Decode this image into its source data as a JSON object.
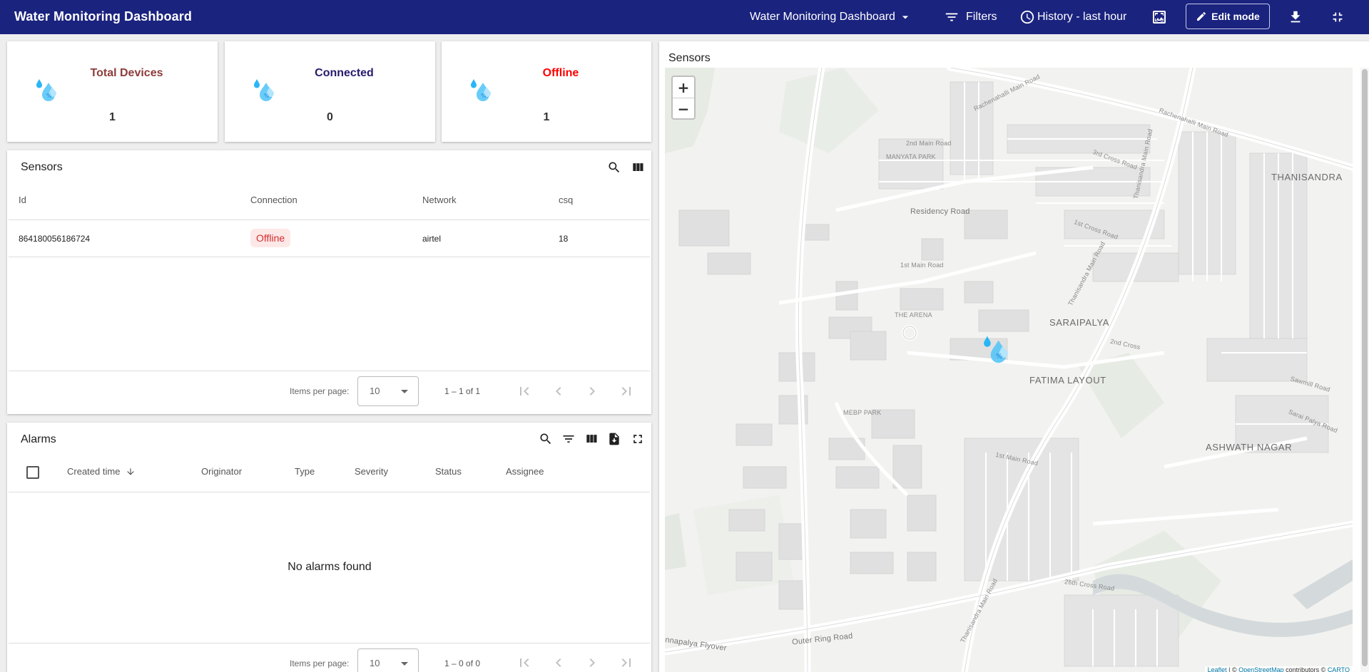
{
  "header": {
    "app_title": "Water Monitoring Dashboard",
    "dashboard_selector": "Water Monitoring Dashboard",
    "filters_label": "Filters",
    "history_label": "History - last hour",
    "edit_mode_label": "Edit mode",
    "icons": [
      "chevron-down-icon",
      "filter-icon",
      "clock-icon",
      "image-icon",
      "pencil-icon",
      "download-icon",
      "exit-fullscreen-icon"
    ]
  },
  "stats": [
    {
      "title": "Total Devices",
      "value": "1",
      "color": "#8d3b3b"
    },
    {
      "title": "Connected",
      "value": "0",
      "color": "#2a1a6e"
    },
    {
      "title": "Offline",
      "value": "1",
      "color": "#ff0000"
    }
  ],
  "sensors_table": {
    "title": "Sensors",
    "columns": [
      "Id",
      "Connection",
      "Network",
      "csq"
    ],
    "rows": [
      {
        "id": "864180056186724",
        "connection": "Offline",
        "network": "airtel",
        "csq": "18"
      }
    ],
    "items_per_page_label": "Items per page:",
    "items_per_page": "10",
    "range": "1 – 1 of 1"
  },
  "alarms_table": {
    "title": "Alarms",
    "columns": [
      "Created time",
      "Originator",
      "Type",
      "Severity",
      "Status",
      "Assignee"
    ],
    "empty_message": "No alarms found",
    "items_per_page_label": "Items per page:",
    "items_per_page": "10",
    "range": "1 – 0 of 0"
  },
  "map": {
    "title": "Sensors",
    "zoom_in": "+",
    "zoom_out": "−",
    "labels": {
      "rachenahalli": "Rachenahalli Main Road",
      "rachenahalli2": "Rachenahalli Main Road",
      "manyata": "MANYATA PARK",
      "second_main": "2nd Main Road",
      "residency": "Residency Road",
      "first_main": "1st Main Road",
      "arena": "THE ARENA",
      "thanisandra": "THANISANDRA",
      "saraipalya": "SARAIPALYA",
      "fatima": "FATIMA LAYOUT",
      "mebp": "MEBP PARK",
      "ashwath": "ASHWATH NAGAR",
      "outer_ring": "Outer Ring Road",
      "flyover": "nnapalya Flyover",
      "thanisandra_main": "Thanisandra Main Road",
      "thanisandra_main2": "Thanisandra Main Road",
      "thanisandra_main3": "Thanisandra Main Road",
      "third_cross": "3rd Cross Road",
      "first_cross": "1st Cross Road",
      "second_cross": "2nd Cross",
      "sawmill": "Sawmill Road",
      "saraipal": "Sarai Palya Road",
      "first_main_b": "1st Main Road",
      "twenty_sixth": "26th Cross Road"
    },
    "attribution_leaflet": "Leaflet",
    "attribution_mid": " | © ",
    "attribution_osm": "OpenStreetMap",
    "attribution_tail": " contributors © ",
    "attribution_carto": "CARTO"
  },
  "colors": {
    "header_bg": "#1a237e",
    "offline_red": "#d32f2f",
    "water_icon": "#4fc3f7"
  }
}
